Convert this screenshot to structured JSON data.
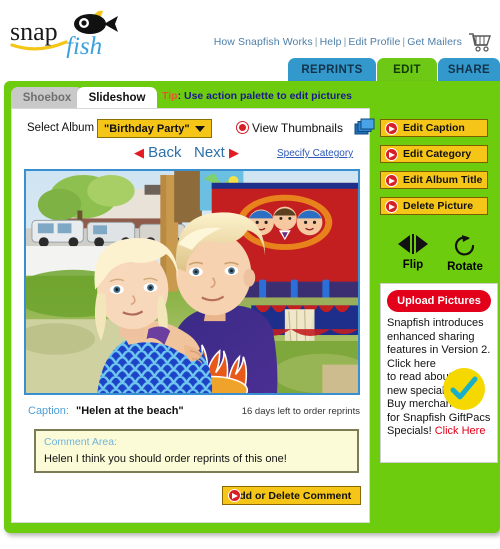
{
  "brand": {
    "name_top": "snap",
    "name_bottom": "fish",
    "logo_icon": "fish-icon"
  },
  "header": {
    "links": [
      {
        "label": "How Snapfish Works"
      },
      {
        "label": "Help"
      },
      {
        "label": "Edit Profile"
      },
      {
        "label": "Get Mailers"
      }
    ],
    "separator": "|",
    "cart_icon": "shopping-cart-icon"
  },
  "top_tabs": [
    {
      "label": "REPRINTS",
      "active": false
    },
    {
      "label": "EDIT",
      "active": true
    },
    {
      "label": "SHARE",
      "active": false
    }
  ],
  "section_tabs": [
    {
      "label": "Shoebox",
      "active": false
    },
    {
      "label": "Slideshow",
      "active": true
    }
  ],
  "tip": {
    "prefix": "Tip",
    "separator": ": ",
    "text": "Use action palette to edit pictures"
  },
  "album": {
    "label": "Select Album",
    "selected": "\"Birthday Party\"",
    "caret_icon": "chevron-down-icon",
    "view_thumbnails_label": "View Thumbnails",
    "thumbnails_icon": "stacked-photos-icon",
    "bullet_icon": "red-dot-icon"
  },
  "navigation": {
    "back_label": "Back",
    "next_label": "Next",
    "back_arrow": "◀",
    "next_arrow": "▶",
    "specify_category_label": "Specify Category"
  },
  "photo": {
    "alt": "Two blond children at an outdoor fair, younger girl hugged by older boy in purple flame shirt"
  },
  "caption": {
    "label": "Caption:",
    "value": "\"Helen at the beach\"",
    "reprints_note": "16 days left to order reprints"
  },
  "comment": {
    "title": "Comment Area:",
    "text": "Helen I think you should order reprints of this one!",
    "button_label": "Add or Delete Comment",
    "button_bullet_icon": "red-arrow-bullet-icon"
  },
  "actions": [
    {
      "label": "Edit Caption",
      "icon": "red-arrow-bullet-icon"
    },
    {
      "label": "Edit Category",
      "icon": "red-arrow-bullet-icon"
    },
    {
      "label": "Edit Album Title",
      "icon": "red-arrow-bullet-icon"
    },
    {
      "label": "Delete Picture",
      "icon": "red-arrow-bullet-icon"
    }
  ],
  "tools": [
    {
      "label": "Flip",
      "icon": "flip-horizontal-icon"
    },
    {
      "label": "Rotate",
      "icon": "rotate-clockwise-icon"
    }
  ],
  "upload": {
    "button_label": "Upload Pictures",
    "promo_line1": "Snapfish introduces",
    "promo_line2": "enhanced sharing",
    "promo_line3": "features in Version 2.",
    "promo_line4": "Click here",
    "promo_line5": "to read about",
    "promo_line6": "new specials.",
    "promo_line7": "Buy merchandise",
    "promo_line8": "for Snapfish GiftPacs",
    "promo_line9": "Specials!",
    "promo_link": "Click Here",
    "check_icon": "checkmark-badge-icon"
  },
  "colors": {
    "panel_green": "#6ecc0e",
    "tab_blue": "#3399cc",
    "button_yellow": "#f5c518",
    "accent_red": "#e3001b",
    "photo_border_blue": "#3a8fd0",
    "comment_bg": "#fbfbd8",
    "link_blue": "#4d7fa8"
  }
}
